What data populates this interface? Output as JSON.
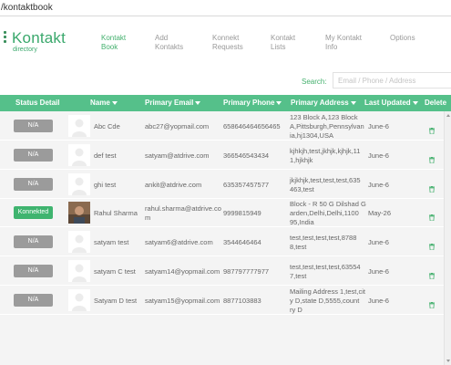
{
  "browser": {
    "url": "/kontaktbook"
  },
  "brand": {
    "title": "Kontakt",
    "subtitle": "directory",
    "accent": "#43b06d"
  },
  "nav": [
    {
      "line1": "Kontakt",
      "line2": "Book",
      "active": true
    },
    {
      "line1": "Add",
      "line2": "Kontakts",
      "active": false
    },
    {
      "line1": "Konnekt",
      "line2": "Requests",
      "active": false
    },
    {
      "line1": "Kontakt",
      "line2": "Lists",
      "active": false
    },
    {
      "line1": "My Kontakt",
      "line2": "Info",
      "active": false
    },
    {
      "line1": "Options",
      "line2": "",
      "active": false
    }
  ],
  "search": {
    "label": "Search:",
    "placeholder": "Email / Phone / Address"
  },
  "table": {
    "header_color": "#55c08a",
    "columns": {
      "status": "Status Detail",
      "name": "Name",
      "email": "Primary Email",
      "phone": "Primary Phone",
      "address": "Primary Address",
      "updated": "Last Updated",
      "delete": "Delete"
    },
    "rows": [
      {
        "status": "N/A",
        "connected": false,
        "name": "Abc Cde",
        "email": "abc27@yopmail.com",
        "phone": "658646464656465",
        "address": [
          "123 Block A,123 Block",
          "A,Pittsburgh,Pennsylvan",
          "ia,hj1304,USA"
        ],
        "updated": "June-6",
        "has_photo": false
      },
      {
        "status": "N/A",
        "connected": false,
        "name": "def test",
        "email": "satyam@atdrive.com",
        "phone": "366546543434",
        "address": [
          "kjhkjh,test,jkhjk,kjhjk,11",
          "1,hjkhjk"
        ],
        "updated": "June-6",
        "has_photo": false
      },
      {
        "status": "N/A",
        "connected": false,
        "name": "ghi test",
        "email": "ankit@atdrive.com",
        "phone": "635357457577",
        "address": [
          "jkjkhjk,test,test,test,635",
          "463,test"
        ],
        "updated": "June-6",
        "has_photo": false
      },
      {
        "status": "Konnekted",
        "connected": true,
        "name": "Rahul Sharma",
        "email": [
          "rahul.sharma@atdrive.co",
          "m"
        ],
        "phone": "9999815949",
        "address": [
          "Block - R 50 G Dilshad G",
          "arden,Delhi,Delhi,1100",
          "95,India"
        ],
        "updated": "May-26",
        "has_photo": true
      },
      {
        "status": "N/A",
        "connected": false,
        "name": "satyam test",
        "email": "satyam6@atdrive.com",
        "phone": "3544646464",
        "address": [
          "test,test,test,test,8788",
          "8,test"
        ],
        "updated": "June-6",
        "has_photo": false
      },
      {
        "status": "N/A",
        "connected": false,
        "name": "satyam C test",
        "email": "satyam14@yopmail.com",
        "phone": "987797777977",
        "address": [
          "test,test,test,test,63554",
          "7,test"
        ],
        "updated": "June-6",
        "has_photo": false
      },
      {
        "status": "N/A",
        "connected": false,
        "name": "Satyam D test",
        "email": "satyam15@yopmail.com",
        "phone": "8877103883",
        "address": [
          "Mailing Address 1,test,cit",
          "y D,state D,5555,count",
          "ry D"
        ],
        "updated": "June-6",
        "has_photo": false
      }
    ]
  }
}
